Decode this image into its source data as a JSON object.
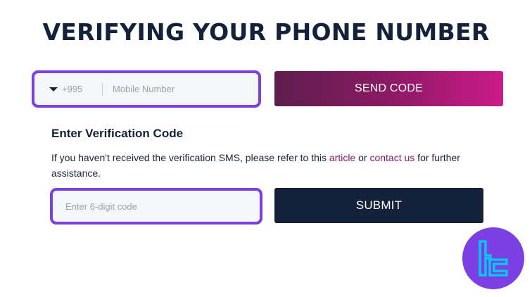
{
  "page": {
    "title": "VERIFYING YOUR PHONE NUMBER"
  },
  "phone": {
    "country_code": "+995",
    "placeholder": "Mobile Number",
    "send_label": "SEND CODE"
  },
  "verification": {
    "heading": "Enter Verification Code",
    "info_prefix": "If you haven't received the verification SMS, please refer to this ",
    "article_link": "article",
    "info_middle": " or ",
    "contact_link": "contact us",
    "info_suffix": " for further assistance.",
    "code_placeholder": "Enter 6-digit code",
    "submit_label": "SUBMIT"
  },
  "colors": {
    "accent_border": "#7b3fe4",
    "send_gradient_start": "#5e1e4d",
    "send_gradient_end": "#cc1a8a",
    "submit_bg": "#13223a",
    "link": "#8a1a63"
  },
  "icons": {
    "country_dropdown": "caret-down-icon",
    "badge": "tc-logo-icon"
  }
}
